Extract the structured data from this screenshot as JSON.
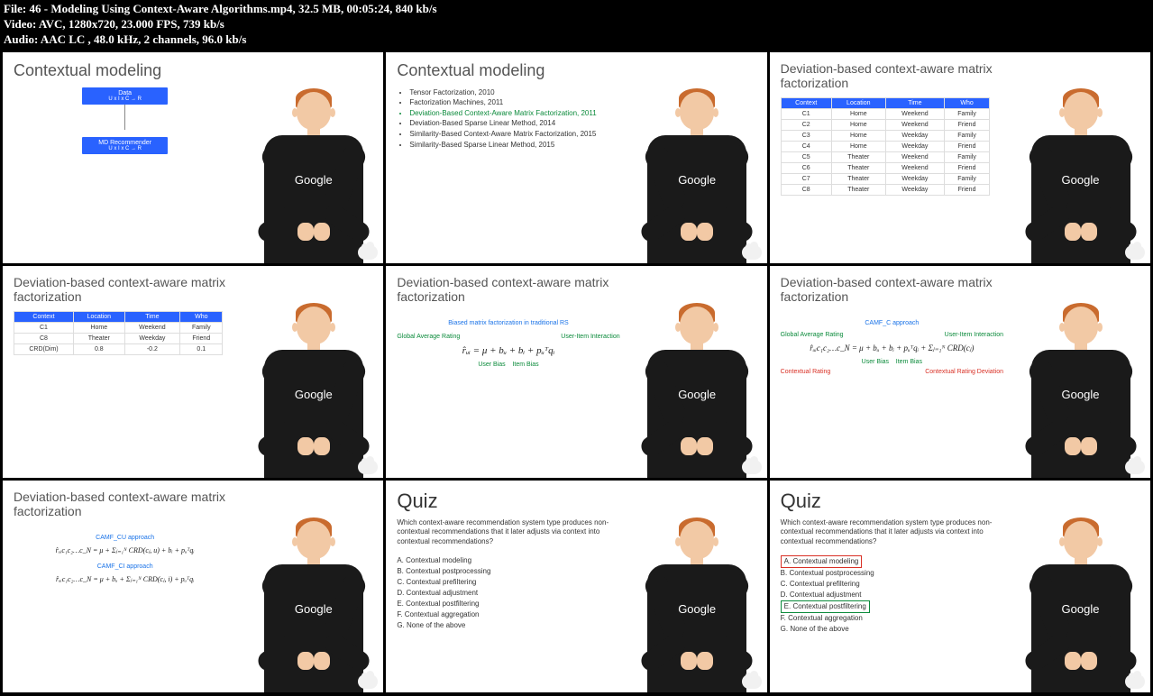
{
  "header": {
    "file": "File: 46 - Modeling Using Context-Aware Algorithms.mp4, 32.5 MB, 00:05:24, 840 kb/s",
    "video": "Video: AVC, 1280x720, 23.000 FPS, 739 kb/s",
    "audio": "Audio: AAC LC , 48.0 kHz, 2 channels, 96.0 kb/s"
  },
  "shirt": "Google",
  "slide1": {
    "title": "Contextual modeling",
    "box1_l1": "Data",
    "box1_l2": "U x I x C → R",
    "box2_l1": "MD Recommender",
    "box2_l2": "U x I x C → R"
  },
  "slide2": {
    "title": "Contextual modeling",
    "items": [
      "Tensor Factorization, 2010",
      "Factorization Machines, 2011",
      "Deviation-Based Context-Aware Matrix Factorization, 2011",
      "Deviation-Based Sparse Linear Method, 2014",
      "Similarity-Based Context-Aware Matrix Factorization, 2015",
      "Similarity-Based Sparse Linear Method, 2015"
    ],
    "hl_index": 2
  },
  "slide3": {
    "title": "Deviation-based context-aware matrix factorization",
    "head": [
      "Context",
      "Location",
      "Time",
      "Who"
    ],
    "rows": [
      [
        "C1",
        "Home",
        "Weekend",
        "Family"
      ],
      [
        "C2",
        "Home",
        "Weekend",
        "Friend"
      ],
      [
        "C3",
        "Home",
        "Weekday",
        "Family"
      ],
      [
        "C4",
        "Home",
        "Weekday",
        "Friend"
      ],
      [
        "C5",
        "Theater",
        "Weekend",
        "Family"
      ],
      [
        "C6",
        "Theater",
        "Weekend",
        "Friend"
      ],
      [
        "C7",
        "Theater",
        "Weekday",
        "Family"
      ],
      [
        "C8",
        "Theater",
        "Weekday",
        "Friend"
      ]
    ]
  },
  "slide4": {
    "title": "Deviation-based context-aware matrix factorization",
    "head": [
      "Context",
      "Location",
      "Time",
      "Who"
    ],
    "rows": [
      [
        "C1",
        "Home",
        "Weekend",
        "Family"
      ],
      [
        "C8",
        "Theater",
        "Weekday",
        "Friend"
      ],
      [
        "CRD(Dim)",
        "0.8",
        "-0.2",
        "0.1"
      ]
    ]
  },
  "slide5": {
    "title": "Deviation-based context-aware matrix factorization",
    "sub": "Biased matrix factorization in traditional RS",
    "l_gar": "Global Average Rating",
    "l_uii": "User-Item Interaction",
    "formula": "r̂ᵤᵢ = μ + bᵤ + bᵢ + pᵤᵀqᵢ",
    "l_ub": "User Bias",
    "l_ib": "Item Bias"
  },
  "slide6": {
    "title": "Deviation-based context-aware matrix factorization",
    "approach": "CAMF_C approach",
    "l_gar": "Global Average Rating",
    "l_uii": "User-Item Interaction",
    "formula": "r̂ᵤᵢc₁c₂…c_N = μ + bᵤ + bᵢ + pᵤᵀqᵢ + Σⱼ₌₁ᴺ CRD(cⱼ)",
    "l_ub": "User Bias",
    "l_ib": "Item Bias",
    "l_cr": "Contextual Rating",
    "l_crd": "Contextual Rating Deviation"
  },
  "slide7": {
    "title": "Deviation-based context-aware matrix factorization",
    "a1": "CAMF_CU approach",
    "f1": "r̂ᵤᵢc₁c₂…c_N = μ + Σⱼ₌₁ᴺ CRD(cⱼ, u) + bᵢ + pᵤᵀqᵢ",
    "a2": "CAMF_CI approach",
    "f2": "r̂ᵤᵢc₁c₂…c_N = μ + bᵤ + Σⱼ₌₁ᴺ CRD(cⱼ, i) + pᵤᵀqᵢ"
  },
  "quiz": {
    "title": "Quiz",
    "q": "Which context-aware recommendation system type produces non-contextual recommendations that it later adjusts via context into contextual recommendations?",
    "opts": [
      "A. Contextual modeling",
      "B. Contextual postprocessing",
      "C. Contextual prefiltering",
      "D. Contextual adjustment",
      "E. Contextual postfiltering",
      "F. Contextual aggregation",
      "G. None of the above"
    ]
  }
}
